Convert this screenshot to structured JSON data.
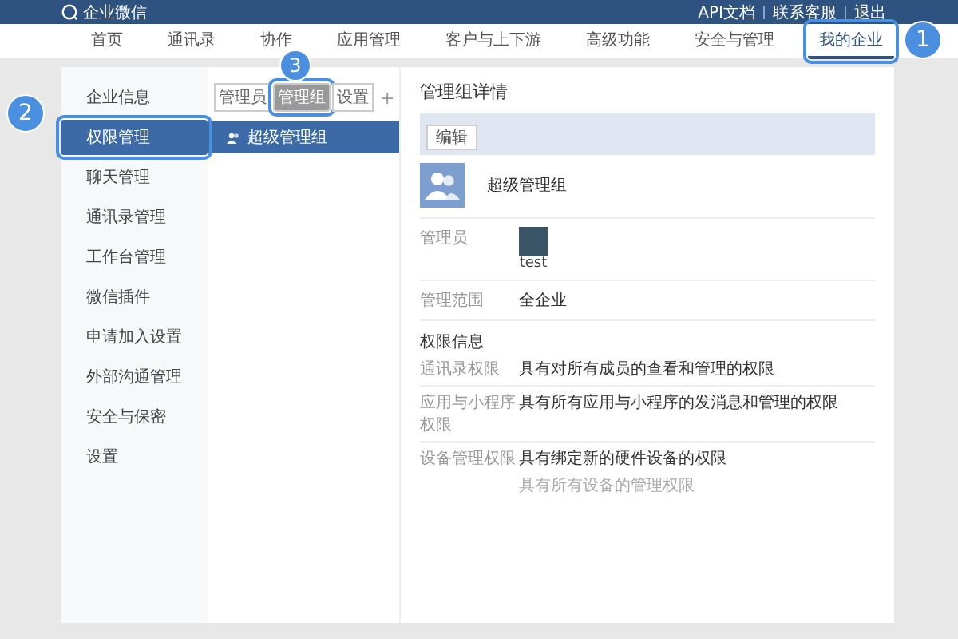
{
  "header": {
    "logo": "企业微信",
    "links": [
      "API文档",
      "联系客服",
      "退出"
    ]
  },
  "nav": [
    {
      "label": "首页",
      "selected": false
    },
    {
      "label": "通讯录",
      "selected": false
    },
    {
      "label": "协作",
      "selected": false
    },
    {
      "label": "应用管理",
      "selected": false
    },
    {
      "label": "客户与上下游",
      "selected": false
    },
    {
      "label": "高级功能",
      "selected": false
    },
    {
      "label": "安全与管理",
      "selected": false
    },
    {
      "label": "我的企业",
      "selected": true,
      "callout": "1"
    }
  ],
  "sidebar": [
    {
      "label": "企业信息",
      "selected": false
    },
    {
      "label": "权限管理",
      "selected": true,
      "callout": "2"
    },
    {
      "label": "聊天管理",
      "selected": false
    },
    {
      "label": "通讯录管理",
      "selected": false
    },
    {
      "label": "工作台管理",
      "selected": false
    },
    {
      "label": "微信插件",
      "selected": false
    },
    {
      "label": "申请加入设置",
      "selected": false
    },
    {
      "label": "外部沟通管理",
      "selected": false
    },
    {
      "label": "安全与保密",
      "selected": false
    },
    {
      "label": "设置",
      "selected": false
    }
  ],
  "group_tabs": {
    "tabs": [
      {
        "label": "管理员",
        "selected": false
      },
      {
        "label": "管理组",
        "selected": true,
        "callout": "3"
      },
      {
        "label": "设置",
        "selected": false
      }
    ],
    "add": "+",
    "groups": [
      {
        "label": "超级管理组",
        "selected": true
      }
    ]
  },
  "detail": {
    "title": "管理组详情",
    "edit_button": "编辑",
    "group_name": "超级管理组",
    "admin_label": "管理员",
    "admin_name": "test",
    "scope_label": "管理范围",
    "scope_value": "全企业",
    "section_title": "权限信息",
    "permissions": [
      {
        "label": "通讯录权限",
        "values": [
          "具有对所有成员的查看和管理的权限"
        ]
      },
      {
        "label": "应用与小程序权限",
        "values": [
          "具有所有应用与小程序的发消息和管理的权限"
        ]
      },
      {
        "label": "设备管理权限",
        "values": [
          "具有绑定新的硬件设备的权限",
          "具有所有设备的管理权限"
        ]
      }
    ]
  }
}
